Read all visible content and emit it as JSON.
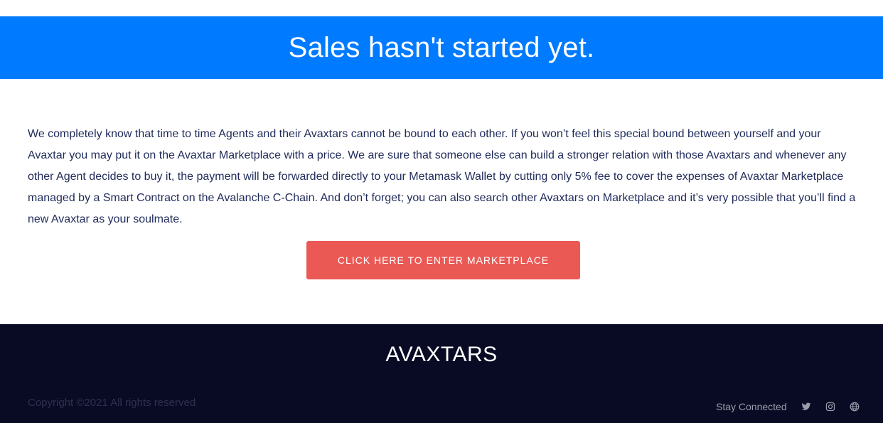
{
  "banner": {
    "title": "Sales hasn't started yet."
  },
  "main": {
    "description": "We completely know that time to time Agents and their Avaxtars cannot be bound to each other. If you won’t feel this special bound between yourself and your Avaxtar you may put it on the Avaxtar Marketplace with a price. We are sure that someone else can build a stronger relation with those Avaxtars and whenever any other Agent decides to buy it, the payment will be forwarded directly to your Metamask Wallet by cutting only 5% fee to cover the expenses of Avaxtar Marketplace managed by a Smart Contract on the Avalanche C-Chain. And don’t forget; you can also search other Avaxtars on Marketplace and it’s very possible that you’ll find a new Avaxtar as your soulmate.",
    "cta_label": "CLICK HERE TO ENTER MARKETPLACE"
  },
  "footer": {
    "brand": "AVAXTARS",
    "copyright": "Copyright ©2021 All rights reserved",
    "stay_connected": "Stay Connected",
    "social_icons": [
      "twitter-icon",
      "instagram-icon",
      "globe-icon"
    ]
  },
  "colors": {
    "banner_bg": "#007bff",
    "cta_bg": "#eb5955",
    "footer_bg": "#090a24",
    "body_text": "#1f2a5a"
  }
}
